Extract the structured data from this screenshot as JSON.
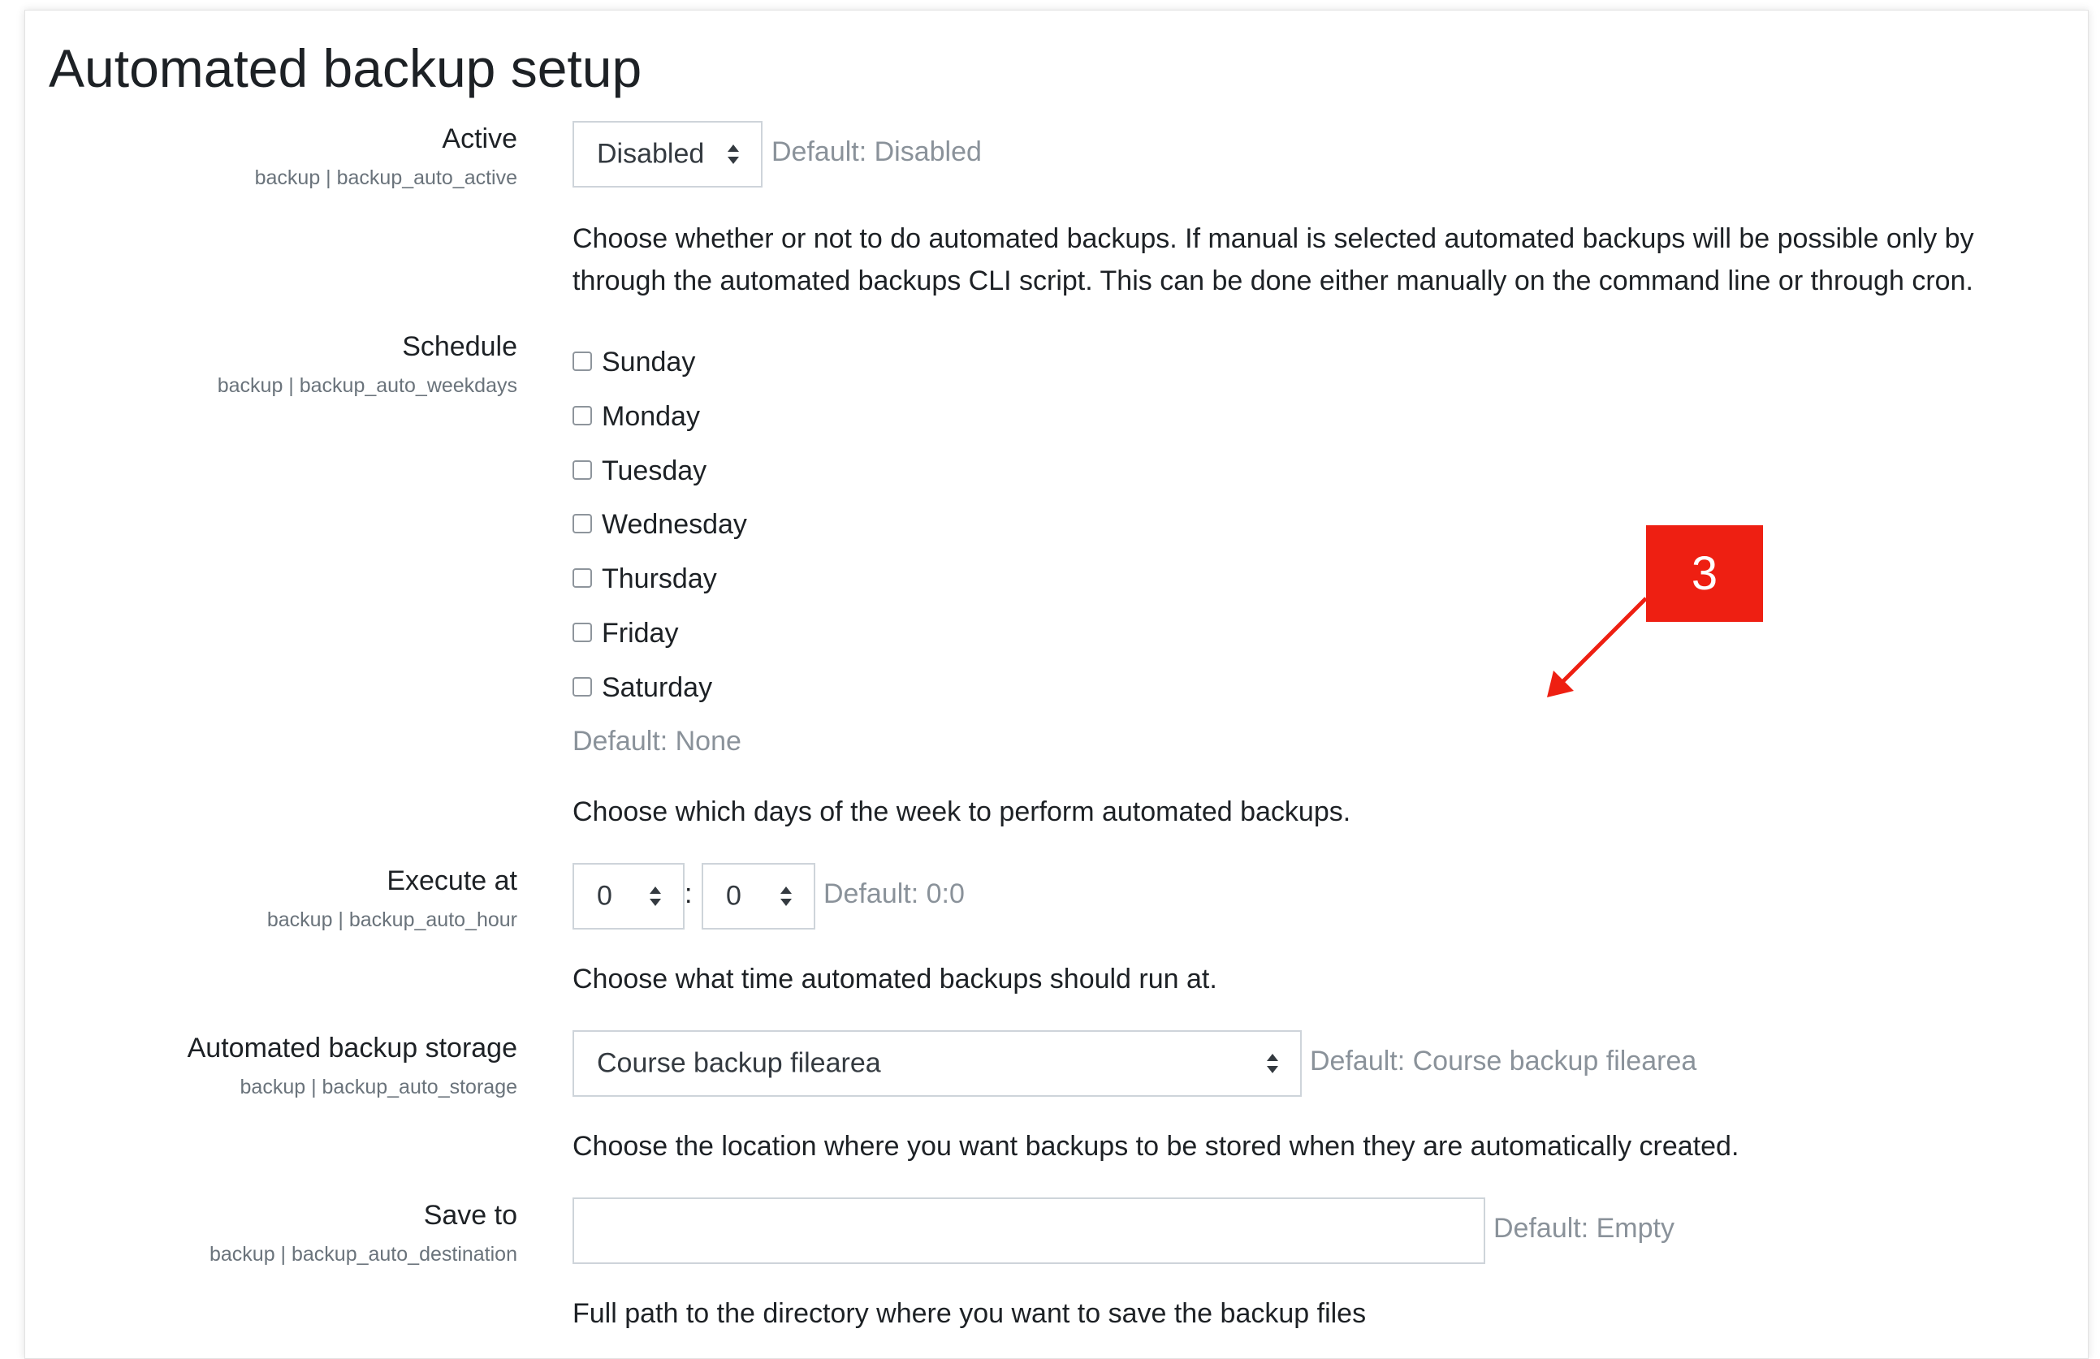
{
  "page": {
    "title": "Automated backup setup"
  },
  "settings": {
    "active": {
      "label": "Active",
      "key": "backup | backup_auto_active",
      "value": "Disabled",
      "default": "Default: Disabled",
      "description_line1": "Choose whether or not to do automated backups. If manual is selected automated backups will be possible only by",
      "description_line2": "through the automated backups CLI script. This can be done either manually on the command line or through cron."
    },
    "schedule": {
      "label": "Schedule",
      "key": "backup | backup_auto_weekdays",
      "days": [
        {
          "label": "Sunday",
          "checked": false
        },
        {
          "label": "Monday",
          "checked": false
        },
        {
          "label": "Tuesday",
          "checked": false
        },
        {
          "label": "Wednesday",
          "checked": false
        },
        {
          "label": "Thursday",
          "checked": false
        },
        {
          "label": "Friday",
          "checked": false
        },
        {
          "label": "Saturday",
          "checked": false
        }
      ],
      "default": "Default: None",
      "description": "Choose which days of the week to perform automated backups."
    },
    "execute_at": {
      "label": "Execute at",
      "key": "backup | backup_auto_hour",
      "hour": "0",
      "separator": ":",
      "minute": "0",
      "default": "Default: 0:0",
      "description": "Choose what time automated backups should run at."
    },
    "storage": {
      "label": "Automated backup storage",
      "key": "backup | backup_auto_storage",
      "value": "Course backup filearea",
      "default": "Default: Course backup filearea",
      "description": "Choose the location where you want backups to be stored when they are automatically created."
    },
    "save_to": {
      "label": "Save to",
      "key": "backup | backup_auto_destination",
      "value": "",
      "default": "Default: Empty",
      "description": "Full path to the directory where you want to save the backup files"
    }
  },
  "annotation": {
    "number": "3",
    "color": "#ee1f12"
  }
}
